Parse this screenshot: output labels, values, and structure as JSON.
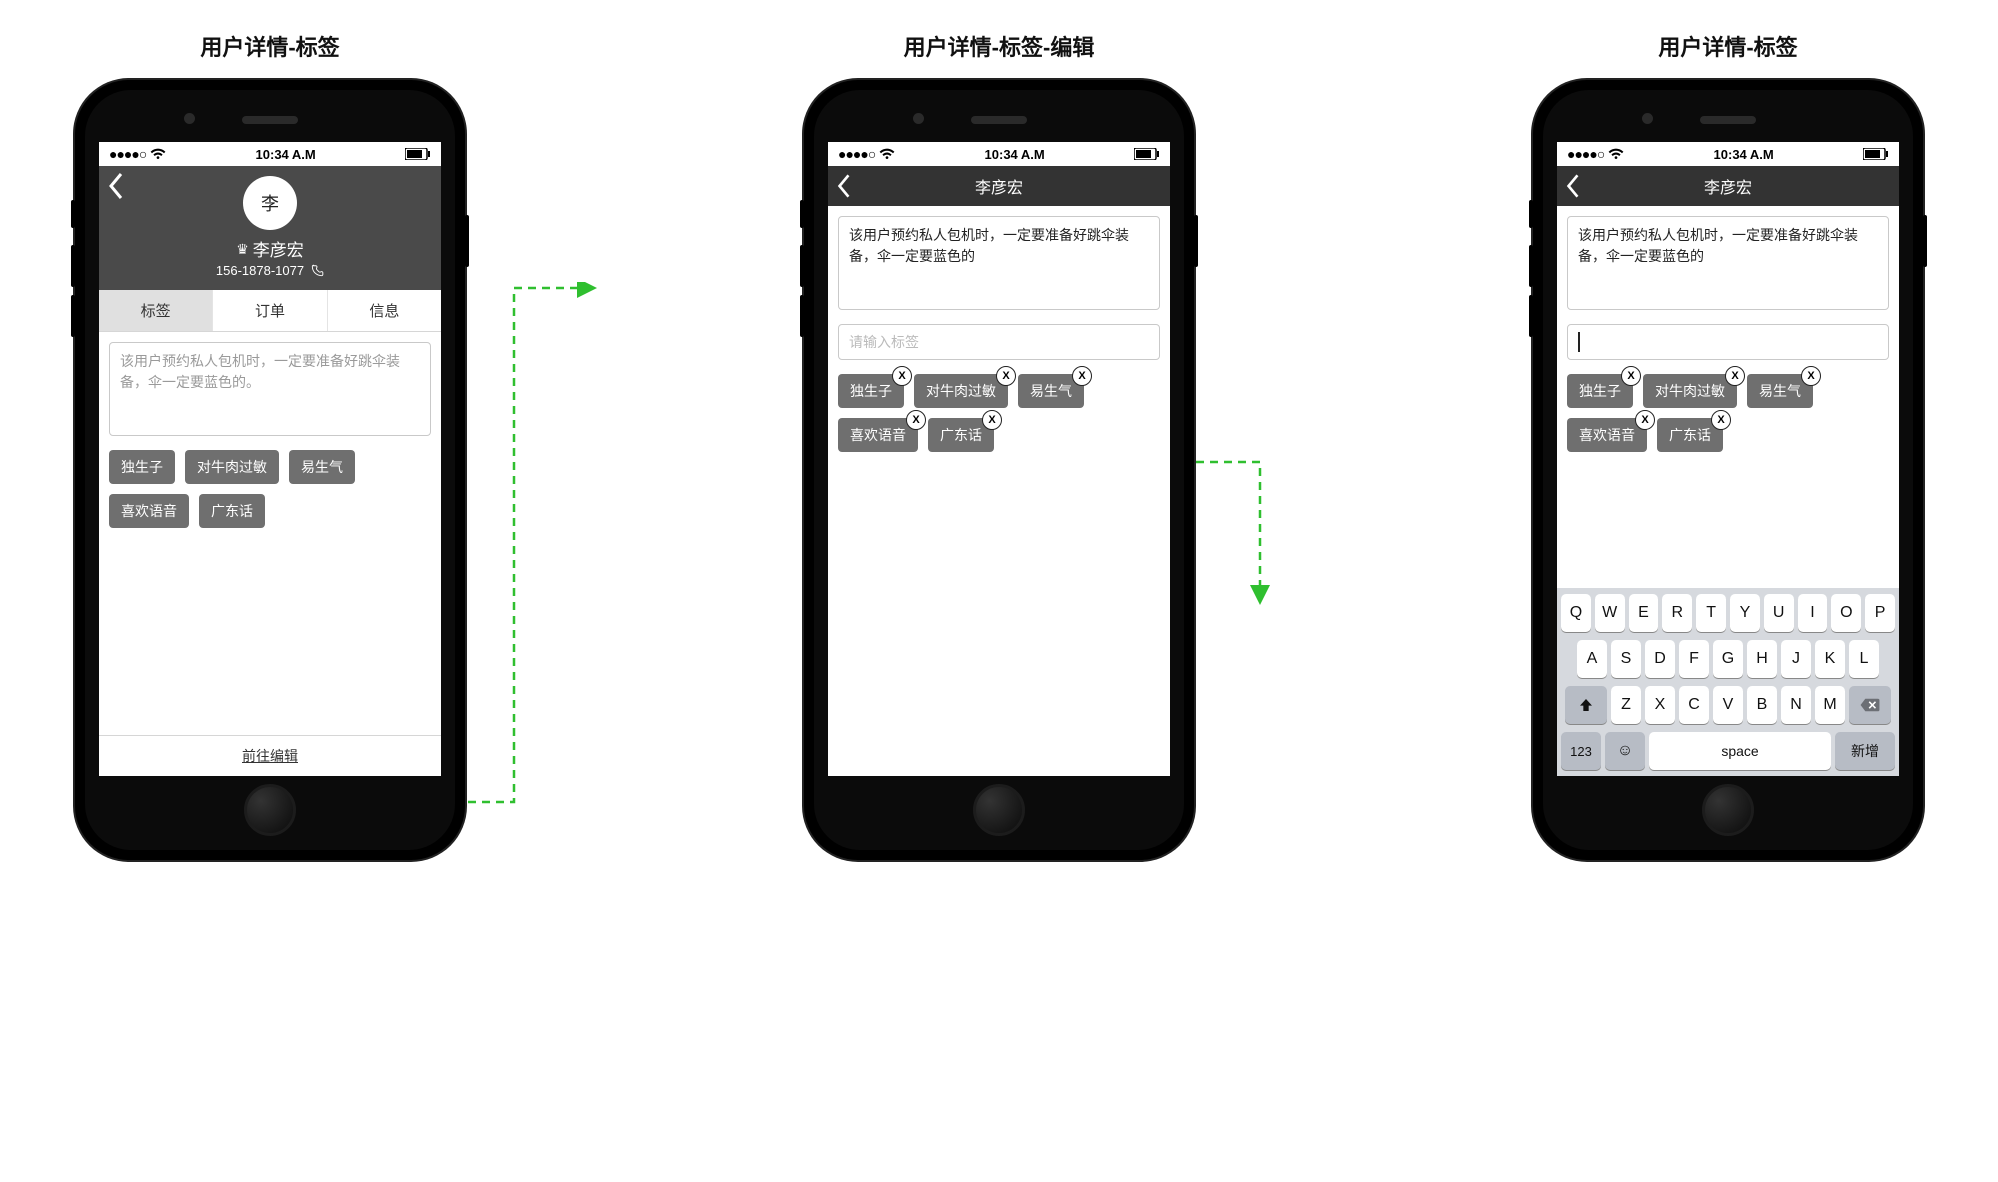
{
  "captions": {
    "screen1": "用户详情-标签",
    "screen2": "用户详情-标签-编辑",
    "screen3": "用户详情-标签"
  },
  "status_bar": {
    "time": "10:34 A.M"
  },
  "user": {
    "avatar_initial": "李",
    "name": "李彦宏",
    "phone": "156-1878-1077"
  },
  "tabs": [
    "标签",
    "订单",
    "信息"
  ],
  "active_tab_index": 0,
  "note_view": "该用户预约私人包机时，一定要准备好跳伞装备，伞一定要蓝色的。",
  "note_edit": "该用户预约私人包机时，一定要准备好跳伞装备，伞一定要蓝色的",
  "tag_input_placeholder": "请输入标签",
  "tags": [
    "独生子",
    "对牛肉过敏",
    "易生气",
    "喜欢语音",
    "广东话"
  ],
  "bottom_link": "前往编辑",
  "keyboard": {
    "row1": [
      "Q",
      "W",
      "E",
      "R",
      "T",
      "Y",
      "U",
      "I",
      "O",
      "P"
    ],
    "row2": [
      "A",
      "S",
      "D",
      "F",
      "G",
      "H",
      "J",
      "K",
      "L"
    ],
    "row3": [
      "Z",
      "X",
      "C",
      "V",
      "B",
      "N",
      "M"
    ],
    "k123": "123",
    "space": "space",
    "enter": "新增"
  }
}
